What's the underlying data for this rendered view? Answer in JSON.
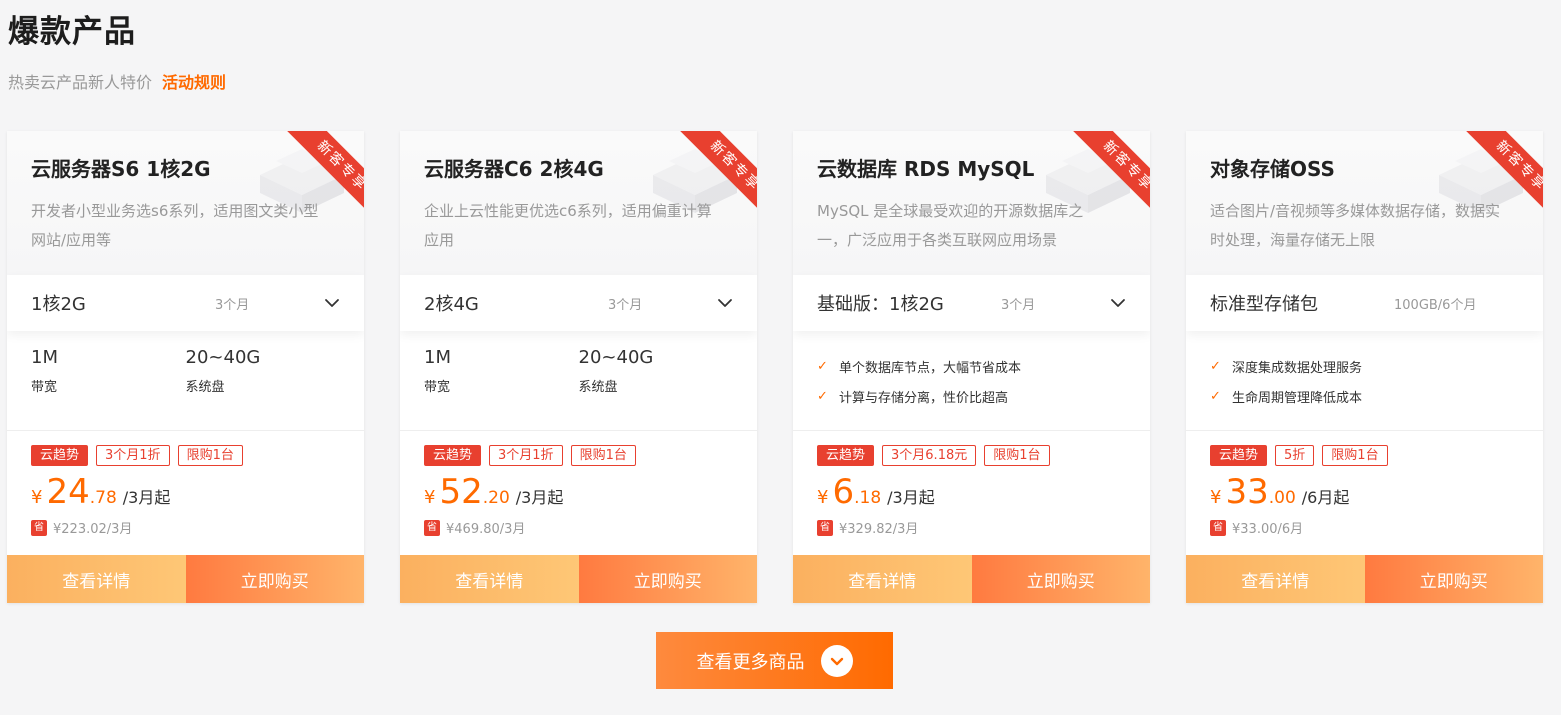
{
  "header": {
    "title": "爆款产品",
    "subtitle": "热卖云产品新人特价",
    "rules_link": "活动规则"
  },
  "products": [
    {
      "title": "云服务器S6 1核2G",
      "desc": "开发者小型业务选s6系列，适用图文类小型网站/应用等",
      "ribbon": "新客专享",
      "spec": "1核2G",
      "duration": "3个月",
      "has_dropdown": true,
      "stats": [
        {
          "value": "1M",
          "label": "带宽"
        },
        {
          "value": "20~40G",
          "label": "系统盘"
        }
      ],
      "checks": [],
      "tags": [
        "云趋势",
        "3个月1折",
        "限购1台"
      ],
      "price_yen": "¥",
      "price_int": "24",
      "price_dec": ".78",
      "price_unit": "/3月起",
      "orig_icon": "省",
      "orig_price": "¥223.02/3月",
      "detail_btn": "查看详情",
      "buy_btn": "立即购买"
    },
    {
      "title": "云服务器C6 2核4G",
      "desc": "企业上云性能更优选c6系列，适用偏重计算应用",
      "ribbon": "新客专享",
      "spec": "2核4G",
      "duration": "3个月",
      "has_dropdown": true,
      "stats": [
        {
          "value": "1M",
          "label": "带宽"
        },
        {
          "value": "20~40G",
          "label": "系统盘"
        }
      ],
      "checks": [],
      "tags": [
        "云趋势",
        "3个月1折",
        "限购1台"
      ],
      "price_yen": "¥",
      "price_int": "52",
      "price_dec": ".20",
      "price_unit": "/3月起",
      "orig_icon": "省",
      "orig_price": "¥469.80/3月",
      "detail_btn": "查看详情",
      "buy_btn": "立即购买"
    },
    {
      "title": "云数据库 RDS MySQL",
      "desc": "MySQL 是全球最受欢迎的开源数据库之一，广泛应用于各类互联网应用场景",
      "ribbon": "新客专享",
      "spec": "基础版：1核2G",
      "duration": "3个月",
      "has_dropdown": true,
      "stats": [],
      "checks": [
        "单个数据库节点，大幅节省成本",
        "计算与存储分离，性价比超高"
      ],
      "tags": [
        "云趋势",
        "3个月6.18元",
        "限购1台"
      ],
      "price_yen": "¥",
      "price_int": "6",
      "price_dec": ".18",
      "price_unit": "/3月起",
      "orig_icon": "省",
      "orig_price": "¥329.82/3月",
      "detail_btn": "查看详情",
      "buy_btn": "立即购买"
    },
    {
      "title": "对象存储OSS",
      "desc": "适合图片/音视频等多媒体数据存储，数据实时处理，海量存储无上限",
      "ribbon": "新客专享",
      "spec": "标准型存储包",
      "duration": "100GB/6个月",
      "has_dropdown": false,
      "stats": [],
      "checks": [
        "深度集成数据处理服务",
        "生命周期管理降低成本"
      ],
      "tags": [
        "云趋势",
        "5折",
        "限购1台"
      ],
      "price_yen": "¥",
      "price_int": "33",
      "price_dec": ".00",
      "price_unit": "/6月起",
      "orig_icon": "省",
      "orig_price": "¥33.00/6月",
      "detail_btn": "查看详情",
      "buy_btn": "立即购买"
    }
  ],
  "more_button": {
    "label": "查看更多商品"
  },
  "colors": {
    "accent": "#ff6a00",
    "red": "#e8402f"
  }
}
